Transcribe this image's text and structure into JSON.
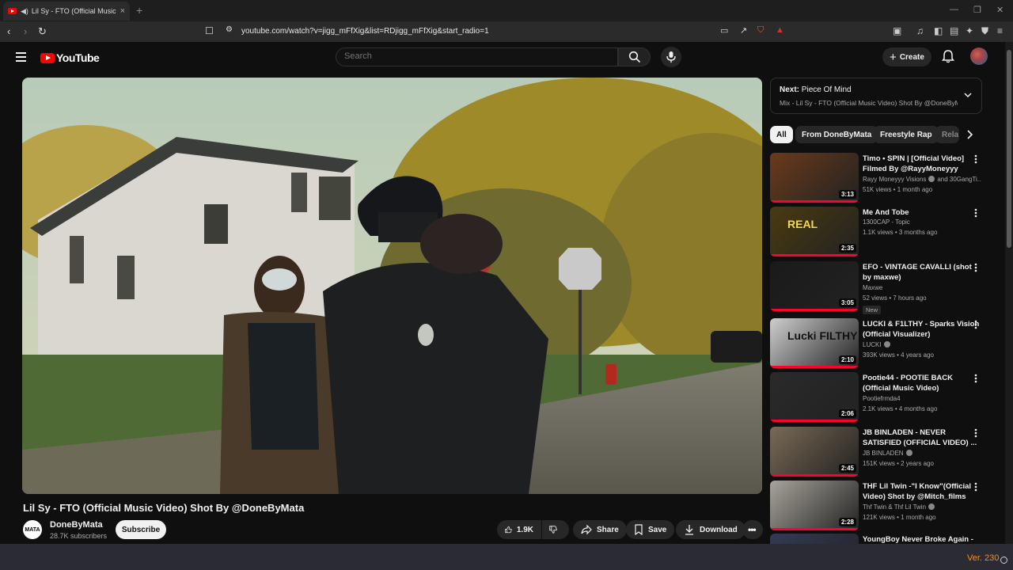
{
  "browser": {
    "tab_title": "Lil Sy - FTO (Official Music Vi",
    "url": "youtube.com/watch?v=jigg_mFfXig&list=RDjigg_mFfXig&start_radio=1"
  },
  "header": {
    "logo_text": "YouTube",
    "search_placeholder": "Search",
    "create_label": "Create"
  },
  "video": {
    "title": "Lil Sy - FTO (Official Music Video) Shot By @DoneByMata",
    "channel_name": "DoneByMata",
    "channel_logo_text": "MATA",
    "subscribers": "28.7K subscribers",
    "subscribe_label": "Subscribe",
    "likes": "1.9K",
    "share_label": "Share",
    "save_label": "Save",
    "download_label": "Download"
  },
  "next_panel": {
    "prefix": "Next:",
    "next_title": "Piece Of Mind",
    "mix_title": "Mix - Lil Sy - FTO (Official Music Video) Shot By @DoneByMata"
  },
  "chips": [
    "All",
    "From DoneByMata",
    "Freestyle Rap",
    "Rela"
  ],
  "recommendations": [
    {
      "title": "Timo • SPIN | [Official Video] Filmed By @RayyMoneyyy",
      "channel": "Rayy Moneyyy Visions",
      "channel_extra": "and 30GangTi...",
      "verified": true,
      "meta": "51K views • 1 month ago",
      "duration": "3:13",
      "thumb_color": "#6b3a1a"
    },
    {
      "title": "Me And Tobe",
      "channel": "1300CAP - Topic",
      "verified": false,
      "meta": "1.1K views • 3 months ago",
      "duration": "2:35",
      "thumb_color": "#4a3a10",
      "thumb_text": "REAL"
    },
    {
      "title": "EFO - VINTAGE CAVALLI (shot by maxwe)",
      "channel": "Maxwe",
      "verified": false,
      "meta": "52 views • 7 hours ago",
      "duration": "3:05",
      "badge": "New",
      "thumb_color": "#1a1a1a"
    },
    {
      "title": "LUCKI & F1LTHY - Sparks Vision (Official Visualizer)",
      "channel": "LUCKI",
      "verified": true,
      "meta": "393K views • 4 years ago",
      "duration": "2:10",
      "thumb_color": "#cfcfcf",
      "thumb_text": "Lucki FILTHY"
    },
    {
      "title": "Pootie44 - POOTIE BACK (Official Music Video)",
      "channel": "Pootiefrmda4",
      "verified": false,
      "meta": "2.1K views • 4 months ago",
      "duration": "2:06",
      "thumb_color": "#2a2a2a"
    },
    {
      "title": "JB BINLADEN - NEVER SATISFIED (OFFICIAL VIDEO) ...",
      "channel": "JB BINLADEN",
      "verified": true,
      "meta": "151K views • 2 years ago",
      "duration": "2:45",
      "thumb_color": "#7a6a55"
    },
    {
      "title": "THF Lil Twin -\"I Know\"(Official Video) Shot by @Mitch_films",
      "channel": "Thf Twin & Thf Lil Twin",
      "verified": true,
      "meta": "121K views • 1 month ago",
      "duration": "2:28",
      "thumb_color": "#a8a49c"
    },
    {
      "title": "YoungBoy Never Broke Again -",
      "channel": "",
      "verified": false,
      "meta": "",
      "duration": "",
      "thumb_color": "#333a55"
    }
  ],
  "footer": {
    "version": "Ver. 230"
  }
}
